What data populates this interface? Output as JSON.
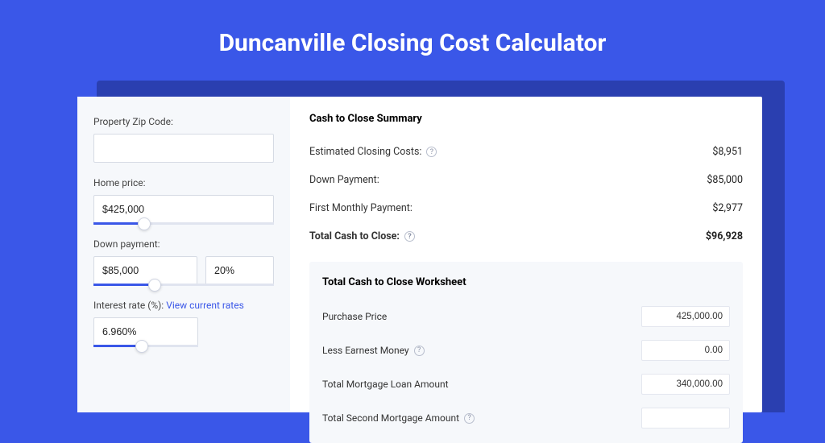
{
  "header": {
    "title": "Duncanville Closing Cost Calculator"
  },
  "form": {
    "zip": {
      "label": "Property Zip Code:",
      "value": ""
    },
    "home_price": {
      "label": "Home price:",
      "value": "$425,000",
      "fill_pct": 28
    },
    "down_payment": {
      "label": "Down payment:",
      "value": "$85,000",
      "pct": "20%",
      "fill_pct": 34
    },
    "interest": {
      "label": "Interest rate (%):",
      "link": "View current rates",
      "value": "6.960%",
      "fill_pct": 46
    }
  },
  "summary": {
    "title": "Cash to Close Summary",
    "rows": [
      {
        "label": "Estimated Closing Costs:",
        "help": true,
        "value": "$8,951"
      },
      {
        "label": "Down Payment:",
        "help": false,
        "value": "$85,000"
      },
      {
        "label": "First Monthly Payment:",
        "help": false,
        "value": "$2,977"
      }
    ],
    "total": {
      "label": "Total Cash to Close:",
      "help": true,
      "value": "$96,928"
    }
  },
  "worksheet": {
    "title": "Total Cash to Close Worksheet",
    "rows": [
      {
        "label": "Purchase Price",
        "help": false,
        "value": "425,000.00"
      },
      {
        "label": "Less Earnest Money",
        "help": true,
        "value": "0.00"
      },
      {
        "label": "Total Mortgage Loan Amount",
        "help": false,
        "value": "340,000.00"
      },
      {
        "label": "Total Second Mortgage Amount",
        "help": true,
        "value": ""
      }
    ]
  }
}
